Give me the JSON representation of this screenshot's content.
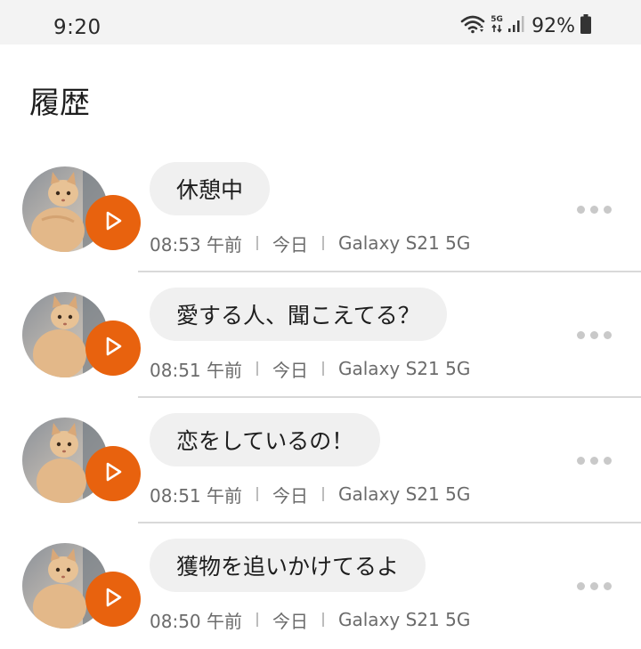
{
  "status_bar": {
    "time": "9:20",
    "network": "5G",
    "battery": "92%"
  },
  "page": {
    "title": "履歴"
  },
  "history": [
    {
      "text": "休憩中",
      "time": "08:53 午前",
      "day": "今日",
      "device": "Galaxy S21 5G"
    },
    {
      "text": "愛する人、聞こえてる？",
      "time": "08:51 午前",
      "day": "今日",
      "device": "Galaxy S21 5G"
    },
    {
      "text": "恋をしているの！",
      "time": "08:51 午前",
      "day": "今日",
      "device": "Galaxy S21 5G"
    },
    {
      "text": "獲物を追いかけてるよ",
      "time": "08:50 午前",
      "day": "今日",
      "device": "Galaxy S21 5G"
    }
  ],
  "icons": {
    "avatar": "cat-photo-avatar",
    "play": "play-icon",
    "more": "more-icon"
  },
  "colors": {
    "accent": "#e8620e",
    "bubble": "#f0f0f0",
    "status_bar": "#f3f3f3"
  }
}
